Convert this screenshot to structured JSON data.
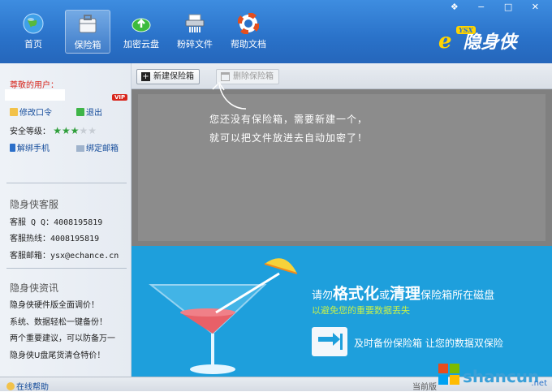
{
  "window_controls": "❖ − □ ✕",
  "nav": [
    {
      "label": "首页",
      "icon": "globe-icon"
    },
    {
      "label": "保险箱",
      "icon": "safe-box-icon"
    },
    {
      "label": "加密云盘",
      "icon": "cloud-upload-icon"
    },
    {
      "label": "粉碎文件",
      "icon": "shredder-icon"
    },
    {
      "label": "帮助文档",
      "icon": "lifebuoy-icon"
    }
  ],
  "logo": {
    "badge": "YSX",
    "text": "隐身侠"
  },
  "sidebar": {
    "greeting": "尊敬的用户：",
    "vip": "VIP",
    "change_password": "修改口令",
    "logout": "退出",
    "security_label": "安全等级：",
    "security_level": 3,
    "security_max": 5,
    "unbind_phone": "解绑手机",
    "bind_email": "绑定邮箱",
    "service_title": "隐身侠客服",
    "qq": "客服 Q Q：4008195819",
    "hotline": "客服热线：4008195819",
    "email": "客服邮箱：ysx@echance.cn",
    "news_title": "隐身侠资讯",
    "news": [
      "隐身侠硬件版全面调价！",
      "系统、数据轻松一键备份！",
      "两个重要建议，可以防备万一",
      "隐身侠U盘尾货清仓特价！"
    ]
  },
  "toolbar": {
    "new_safe": "新建保险箱",
    "delete_safe": "删除保险箱"
  },
  "empty_hint": [
    "您还没有保险箱，需要新建一个，",
    "就可以把文件放进去自动加密了！"
  ],
  "banner": {
    "p1": "请勿",
    "k1": "格式化",
    "p2": "或",
    "k2": "清理",
    "p3": "保险箱所在磁盘",
    "sub": "以避免您的重要数据丢失",
    "backup": "及时备份保险箱 让您的数据双保险"
  },
  "status": {
    "help": "在线帮助",
    "version_prefix": "当前版",
    "watermark": "shancun",
    "watermark_sub": ".net"
  },
  "colors": {
    "header": "#2a72c9",
    "banner": "#1e9fdc",
    "accent_green": "#c7f04a",
    "greeting_red": "#d8261c"
  }
}
